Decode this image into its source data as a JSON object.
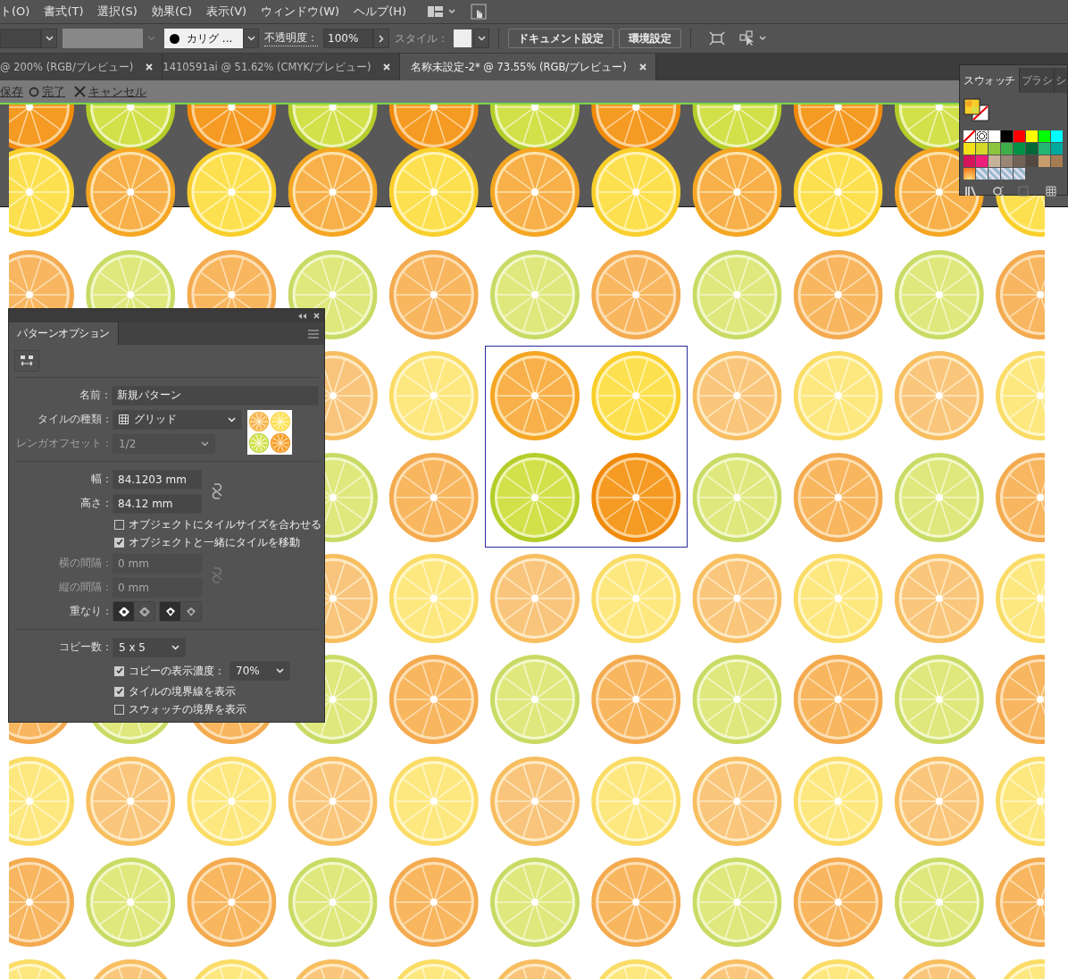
{
  "menu_bar": {
    "items": [
      "ト(O)",
      "書式(T)",
      "選択(S)",
      "効果(C)",
      "表示(V)",
      "ウィンドウ(W)",
      "ヘルプ(H)"
    ]
  },
  "control_bar": {
    "brush": "カリグ ...",
    "opacity_label": "不透明度：",
    "opacity": "100%",
    "style_label": "スタイル：",
    "buttons": [
      "ドキュメント設定",
      "環境設定"
    ]
  },
  "document_tabs": [
    {
      "label": "@ 200% (RGB/プレビュー)",
      "selected": false
    },
    {
      "label": "1410591ai @ 51.62% (CMYK/プレビュー)",
      "selected": false
    },
    {
      "label": "名称未設定-2* @ 73.55% (RGB/プレビュー)",
      "selected": true
    }
  ],
  "edit_bar": {
    "save": "保存",
    "done": "完了",
    "cancel": "キャンセル"
  },
  "pattern_options": {
    "title": "パターンオプション",
    "name": {
      "label": "名前：",
      "value": "新規パターン"
    },
    "tile_type": {
      "label": "タイルの種類：",
      "value": "グリッド"
    },
    "brick_offset": {
      "label": "レンガオフセット：",
      "value": "1/2",
      "disabled": true
    },
    "width": {
      "label": "幅：",
      "value": "84.1203 mm"
    },
    "height": {
      "label": "高さ：",
      "value": "84.12 mm"
    },
    "options": [
      {
        "label": "オブジェクトにタイルサイズを合わせる",
        "checked": false
      },
      {
        "label": "オブジェクトと一緒にタイルを移動",
        "checked": true
      }
    ],
    "h_spacing": {
      "label": "横の間隔：",
      "value": "0 mm",
      "disabled": true
    },
    "v_spacing": {
      "label": "縦の間隔：",
      "value": "0 mm",
      "disabled": true
    },
    "overlap": {
      "label": "重なり：",
      "horizontal": [
        {
          "selected": true
        },
        {
          "selected": false
        }
      ],
      "vertical": [
        {
          "selected": true
        },
        {
          "selected": false
        }
      ]
    },
    "copies": {
      "label": "コピー数：",
      "value": "5 x 5"
    },
    "dim_copies": {
      "label": "コピーの表示濃度：",
      "checked": true,
      "value": "70%"
    },
    "display": [
      {
        "label": "タイルの境界線を表示",
        "checked": true
      },
      {
        "label": "スウォッチの境界を表示",
        "checked": false
      }
    ]
  },
  "swatches_panel": {
    "tabs": [
      {
        "label": "スウォッチ",
        "selected": true
      },
      {
        "label": "ブラシ",
        "selected": false
      },
      {
        "label": "シ",
        "selected": false
      }
    ],
    "swatches": [
      {
        "kind": "none"
      },
      {
        "kind": "registration"
      },
      {
        "kind": "color",
        "color": "#ffffff"
      },
      {
        "kind": "color",
        "color": "#000000"
      },
      {
        "kind": "color",
        "color": "#ff0000"
      },
      {
        "kind": "color",
        "color": "#ffff00"
      },
      {
        "kind": "color",
        "color": "#00ff00"
      },
      {
        "kind": "color",
        "color": "#00ffff"
      },
      {
        "kind": "color",
        "color": "#f5e11a"
      },
      {
        "kind": "color",
        "color": "#d4d92a"
      },
      {
        "kind": "color",
        "color": "#8cc63f"
      },
      {
        "kind": "color",
        "color": "#3fae49"
      },
      {
        "kind": "color",
        "color": "#009245"
      },
      {
        "kind": "color",
        "color": "#006837"
      },
      {
        "kind": "color",
        "color": "#22b573"
      },
      {
        "kind": "color",
        "color": "#00a99d"
      },
      {
        "kind": "color",
        "color": "#d4145a"
      },
      {
        "kind": "color",
        "color": "#ed1e79"
      },
      {
        "kind": "color",
        "color": "#c7b299"
      },
      {
        "kind": "color",
        "color": "#998675"
      },
      {
        "kind": "color",
        "color": "#736357"
      },
      {
        "kind": "color",
        "color": "#534741"
      },
      {
        "kind": "color",
        "color": "#c69c6d"
      },
      {
        "kind": "color",
        "color": "#a67c52"
      },
      {
        "kind": "gradient"
      },
      {
        "kind": "pattern"
      },
      {
        "kind": "pattern"
      },
      {
        "kind": "pattern"
      },
      {
        "kind": "pattern"
      }
    ]
  }
}
